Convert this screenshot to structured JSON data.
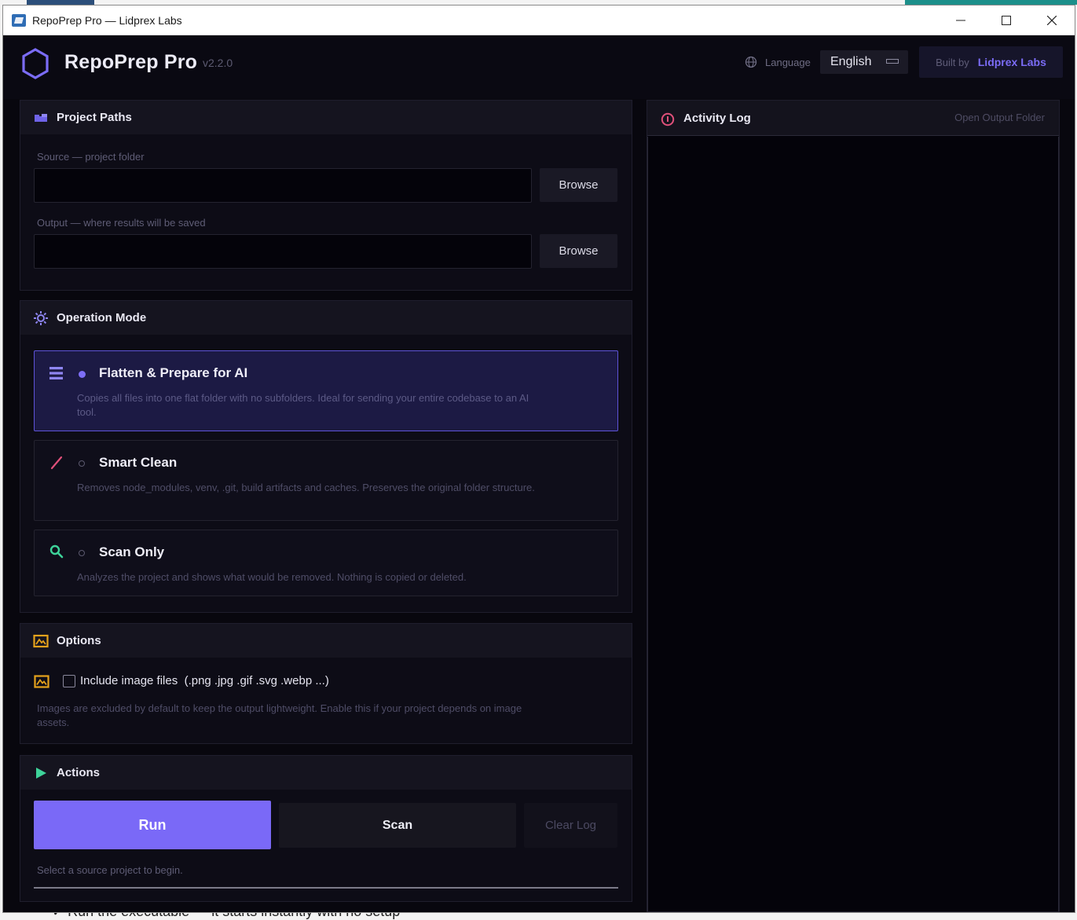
{
  "window": {
    "title": "RepoPrep Pro — Lidprex Labs"
  },
  "header": {
    "app_name": "RepoPrep Pro",
    "version": "v2.2.0",
    "language_label": "Language",
    "language_value": "English",
    "built_by_prefix": "Built by",
    "built_by_brand": "Lidprex Labs",
    "accent_color": "#7b6cf6"
  },
  "project_paths": {
    "title": "Project Paths",
    "source_label": "Source — project folder",
    "source_value": "",
    "output_label": "Output — where results will be saved",
    "output_value": "",
    "browse_label": "Browse"
  },
  "operation_mode": {
    "title": "Operation Mode",
    "modes": [
      {
        "title": "Flatten & Prepare for AI",
        "description": "Copies all files into one flat folder with no subfolders. Ideal for sending your entire codebase to an AI tool.",
        "selected": true,
        "icon": "list-icon"
      },
      {
        "title": "Smart Clean",
        "description": "Removes node_modules, venv, .git, build artifacts and caches. Preserves the original folder structure.",
        "selected": false,
        "icon": "brush-icon"
      },
      {
        "title": "Scan Only",
        "description": "Analyzes the project and shows what would be removed. Nothing is copied or deleted.",
        "selected": false,
        "icon": "magnifier-icon"
      }
    ]
  },
  "options": {
    "title": "Options",
    "include_images_label": "Include image files",
    "include_images_exts": "(.png .jpg .gif .svg .webp ...)",
    "include_images_checked": false,
    "include_images_description": "Images are excluded by default to keep the output lightweight. Enable this if your project depends on image assets."
  },
  "actions": {
    "title": "Actions",
    "run_label": "Run",
    "scan_label": "Scan",
    "clear_label": "Clear Log",
    "status_text": "Select a source project to begin.",
    "progress": 0
  },
  "activity_log": {
    "title": "Activity Log",
    "open_output_label": "Open Output Folder"
  },
  "background": {
    "text": "✓ Run the executable — it starts instantly with no setup"
  }
}
